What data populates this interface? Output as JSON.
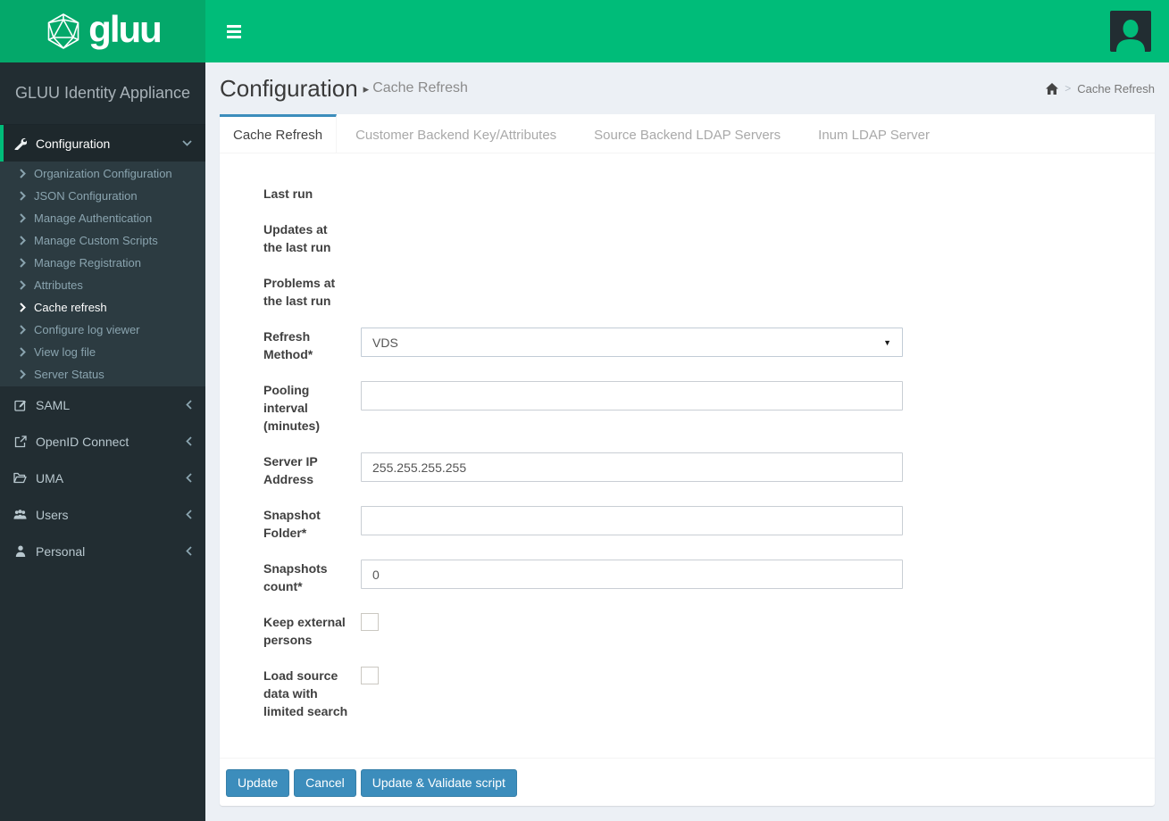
{
  "colors": {
    "navbar_green": "#00bc79",
    "logo_green": "#04a86a",
    "accent_blue": "#3c8dbc",
    "sidebar_bg": "#222d32",
    "submenu_bg": "#2c3b41",
    "content_bg": "#ecf0f5"
  },
  "brand": {
    "logo_text": "gluu",
    "logo_icon": "gluu-polyhedron-icon",
    "appliance_title": "GLUU Identity Appliance"
  },
  "navbar": {
    "toggle_icon": "hamburger-icon",
    "avatar_icon": "user-silhouette-icon"
  },
  "sidebar": {
    "items": [
      {
        "label": "Configuration",
        "icon": "wrench-icon",
        "state": "expanded",
        "active": true,
        "children": [
          "Organization Configuration",
          "JSON Configuration",
          "Manage Authentication",
          "Manage Custom Scripts",
          "Manage Registration",
          "Attributes",
          "Cache refresh",
          "Configure log viewer",
          "View log file",
          "Server Status"
        ],
        "active_child": "Cache refresh"
      },
      {
        "label": "SAML",
        "icon": "edit-icon",
        "state": "collapsed"
      },
      {
        "label": "OpenID Connect",
        "icon": "external-link-icon",
        "state": "collapsed"
      },
      {
        "label": "UMA",
        "icon": "folder-open-icon",
        "state": "collapsed"
      },
      {
        "label": "Users",
        "icon": "users-icon",
        "state": "collapsed"
      },
      {
        "label": "Personal",
        "icon": "user-icon",
        "state": "collapsed"
      }
    ]
  },
  "header": {
    "title": "Configuration",
    "subtitle": "Cache Refresh"
  },
  "breadcrumb": {
    "home_icon": "home-icon",
    "current": "Cache Refresh"
  },
  "tabs": [
    {
      "label": "Cache Refresh",
      "active": true
    },
    {
      "label": "Customer Backend Key/Attributes",
      "active": false
    },
    {
      "label": "Source Backend LDAP Servers",
      "active": false
    },
    {
      "label": "Inum LDAP Server",
      "active": false
    }
  ],
  "form": {
    "fields": [
      {
        "label": "Last run",
        "type": "static",
        "value": ""
      },
      {
        "label": "Updates at the last run",
        "type": "static",
        "value": ""
      },
      {
        "label": "Problems at the last run",
        "type": "static",
        "value": ""
      },
      {
        "label": "Refresh Method*",
        "type": "select",
        "value": "VDS"
      },
      {
        "label": "Pooling interval (minutes)",
        "type": "text",
        "value": ""
      },
      {
        "label": "Server IP Address",
        "type": "text",
        "value": "255.255.255.255"
      },
      {
        "label": "Snapshot Folder*",
        "type": "text",
        "value": ""
      },
      {
        "label": "Snapshots count*",
        "type": "text",
        "value": "0"
      },
      {
        "label": "Keep external persons",
        "type": "checkbox",
        "checked": false
      },
      {
        "label": "Load source data with limited search",
        "type": "checkbox",
        "checked": false
      }
    ]
  },
  "footer": {
    "buttons": [
      "Update",
      "Cancel",
      "Update & Validate script"
    ]
  }
}
